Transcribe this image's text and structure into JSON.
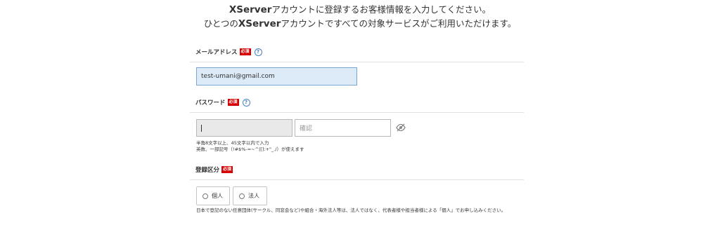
{
  "intro": {
    "line1_brand": "XServer",
    "line1_rest": "アカウントに登録するお客様情報を入力してください。",
    "line2_pre": "ひとつの",
    "line2_brand": "XServer",
    "line2_rest": "アカウントですべての対象サービスがご利用いただけます。"
  },
  "email": {
    "label": "メールアドレス",
    "required": "必須",
    "help": "?",
    "value": "test-umani@gmail.com"
  },
  "password": {
    "label": "パスワード",
    "required": "必須",
    "help": "?",
    "confirm_placeholder": "確認",
    "note_line1": "半角8文字以上、45文字以内で入力",
    "note_line2": "英数、一部記号（!#$%-=~^|[]:+\"_./）が使えます",
    "toggle_icon": "eye-slash-icon"
  },
  "registration_type": {
    "label": "登録区分",
    "required": "必須",
    "options": [
      {
        "label": "個人",
        "selected": false
      },
      {
        "label": "法人",
        "selected": false
      }
    ],
    "note": "日本で登記のない任意団体(サークル、同窓会など)や組合・海外法人等は、法人ではなく、代表者様や担当者様による「個人」でお申し込みください。"
  },
  "colors": {
    "required_badge": "#d60000",
    "email_field_bg": "#dceaf8",
    "email_field_border": "#7aa7d6",
    "password_field_bg": "#e9e9e9",
    "help_icon": "#4a7fc1"
  }
}
